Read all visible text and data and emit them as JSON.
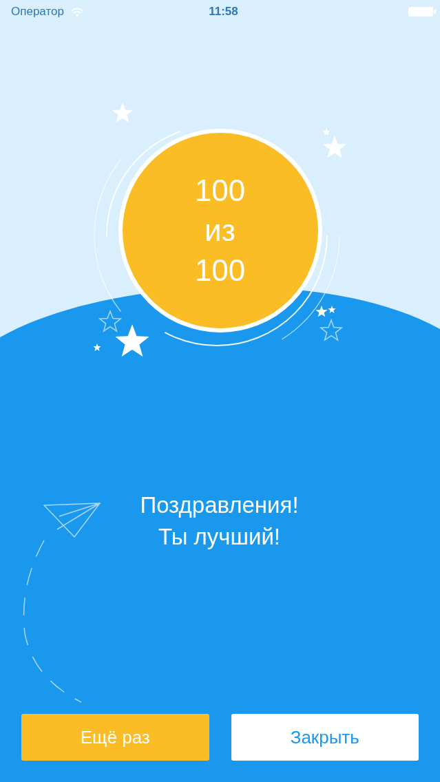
{
  "status_bar": {
    "carrier": "Оператор",
    "time": "11:58"
  },
  "score": {
    "lines": [
      "100",
      "из",
      "100"
    ]
  },
  "message": {
    "lines": [
      "Поздравления!",
      "Ты лучший!"
    ]
  },
  "buttons": [
    {
      "label": "Ещё раз",
      "kind": "primary"
    },
    {
      "label": "Закрыть",
      "kind": "secondary"
    }
  ]
}
